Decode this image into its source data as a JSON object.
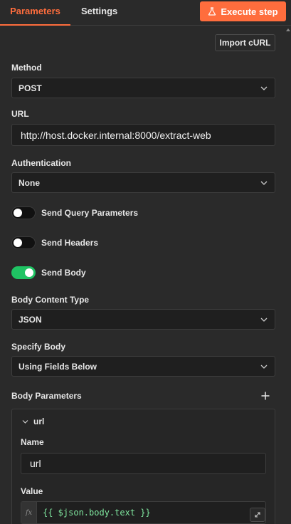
{
  "tabs": {
    "parameters": "Parameters",
    "settings": "Settings"
  },
  "toolbar": {
    "execute_label": "Execute step",
    "import_label": "Import cURL"
  },
  "method": {
    "label": "Method",
    "value": "POST"
  },
  "url": {
    "label": "URL",
    "value": "http://host.docker.internal:8000/extract-web"
  },
  "authentication": {
    "label": "Authentication",
    "value": "None"
  },
  "toggles": {
    "query": {
      "label": "Send Query Parameters",
      "on": false
    },
    "headers": {
      "label": "Send Headers",
      "on": false
    },
    "body": {
      "label": "Send Body",
      "on": true
    }
  },
  "body_content_type": {
    "label": "Body Content Type",
    "value": "JSON"
  },
  "specify_body": {
    "label": "Specify Body",
    "value": "Using Fields Below"
  },
  "body_parameters": {
    "label": "Body Parameters",
    "item": {
      "title": "url",
      "name_label": "Name",
      "name_value": "url",
      "value_label": "Value",
      "fx_label": "fx",
      "value_expression": "{{ $json.body.text }}"
    }
  },
  "colors": {
    "accent": "#ff6d3d",
    "toggle_on": "#1fc363",
    "expression": "#7fe59e"
  }
}
